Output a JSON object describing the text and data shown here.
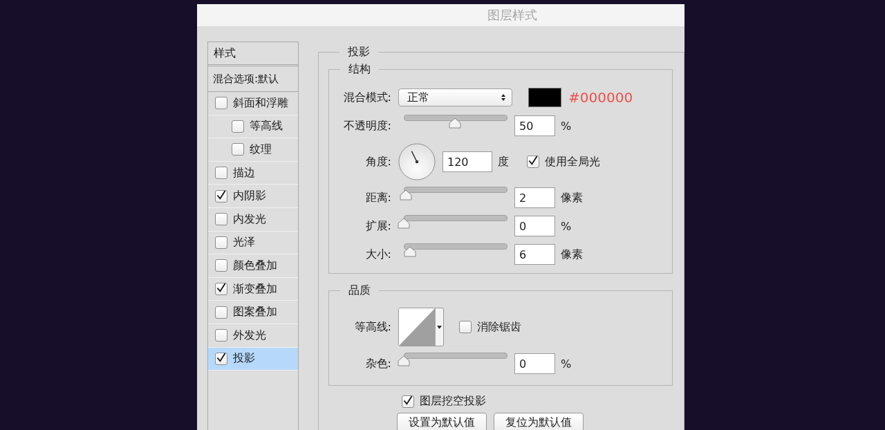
{
  "window": {
    "title": "图层样式"
  },
  "sidebar": {
    "header": "样式",
    "blend_options": "混合选项:默认",
    "items": [
      {
        "label": "斜面和浮雕",
        "checked": false,
        "selected": false,
        "children": [
          {
            "label": "等高线",
            "checked": false,
            "selected": false
          },
          {
            "label": "纹理",
            "checked": false,
            "selected": false
          }
        ]
      },
      {
        "label": "描边",
        "checked": false,
        "selected": false
      },
      {
        "label": "内阴影",
        "checked": true,
        "selected": false
      },
      {
        "label": "内发光",
        "checked": false,
        "selected": false
      },
      {
        "label": "光泽",
        "checked": false,
        "selected": false
      },
      {
        "label": "颜色叠加",
        "checked": false,
        "selected": false
      },
      {
        "label": "渐变叠加",
        "checked": true,
        "selected": false
      },
      {
        "label": "图案叠加",
        "checked": false,
        "selected": false
      },
      {
        "label": "外发光",
        "checked": false,
        "selected": false
      },
      {
        "label": "投影",
        "checked": true,
        "selected": true
      }
    ]
  },
  "panel": {
    "title": "投影",
    "structure": {
      "title": "结构",
      "rows": [
        {
          "kind": "blend",
          "label": "混合模式:",
          "value": "正常",
          "color": "#000000",
          "color_text": "#000000"
        },
        {
          "kind": "slider",
          "label": "不透明度:",
          "level": 0.5,
          "value": "50",
          "unit": "%"
        },
        {
          "kind": "angle",
          "label": "角度:",
          "value": "120",
          "unit": "度",
          "global_light": {
            "label": "使用全局光",
            "checked": true
          }
        },
        {
          "kind": "slider",
          "label": "距离:",
          "level": 0.02,
          "value": "2",
          "unit": "像素"
        },
        {
          "kind": "slider",
          "label": "扩展:",
          "level": 0,
          "value": "0",
          "unit": "%"
        },
        {
          "kind": "slider",
          "label": "大小:",
          "level": 0.06,
          "value": "6",
          "unit": "像素"
        }
      ]
    },
    "quality": {
      "title": "品质",
      "contour": {
        "label": "等高线:"
      },
      "anti_alias": {
        "label": "消除锯齿",
        "checked": false
      },
      "noise": {
        "label": "杂色:",
        "level": 0,
        "value": "0",
        "unit": "%"
      }
    },
    "knockout": {
      "label": "图层挖空投影",
      "checked": true
    },
    "buttons": [
      "设置为默认值",
      "复位为默认值"
    ]
  }
}
